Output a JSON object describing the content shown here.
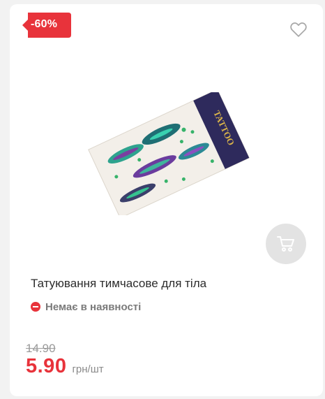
{
  "card": {
    "discount_badge": "-60%",
    "title": "Татуювання тимчасове для тіла",
    "stock_status": "Немає в наявності",
    "old_price": "14.90",
    "price": "5.90",
    "unit": "грн/шт",
    "product_image_text": "TATTOO",
    "icons": [
      "heart-icon",
      "cart-icon",
      "out-of-stock-icon"
    ]
  },
  "colors": {
    "accent": "#e8333b",
    "cart_button_bg": "#e3e3e3",
    "muted_text": "#7a7a7a"
  }
}
